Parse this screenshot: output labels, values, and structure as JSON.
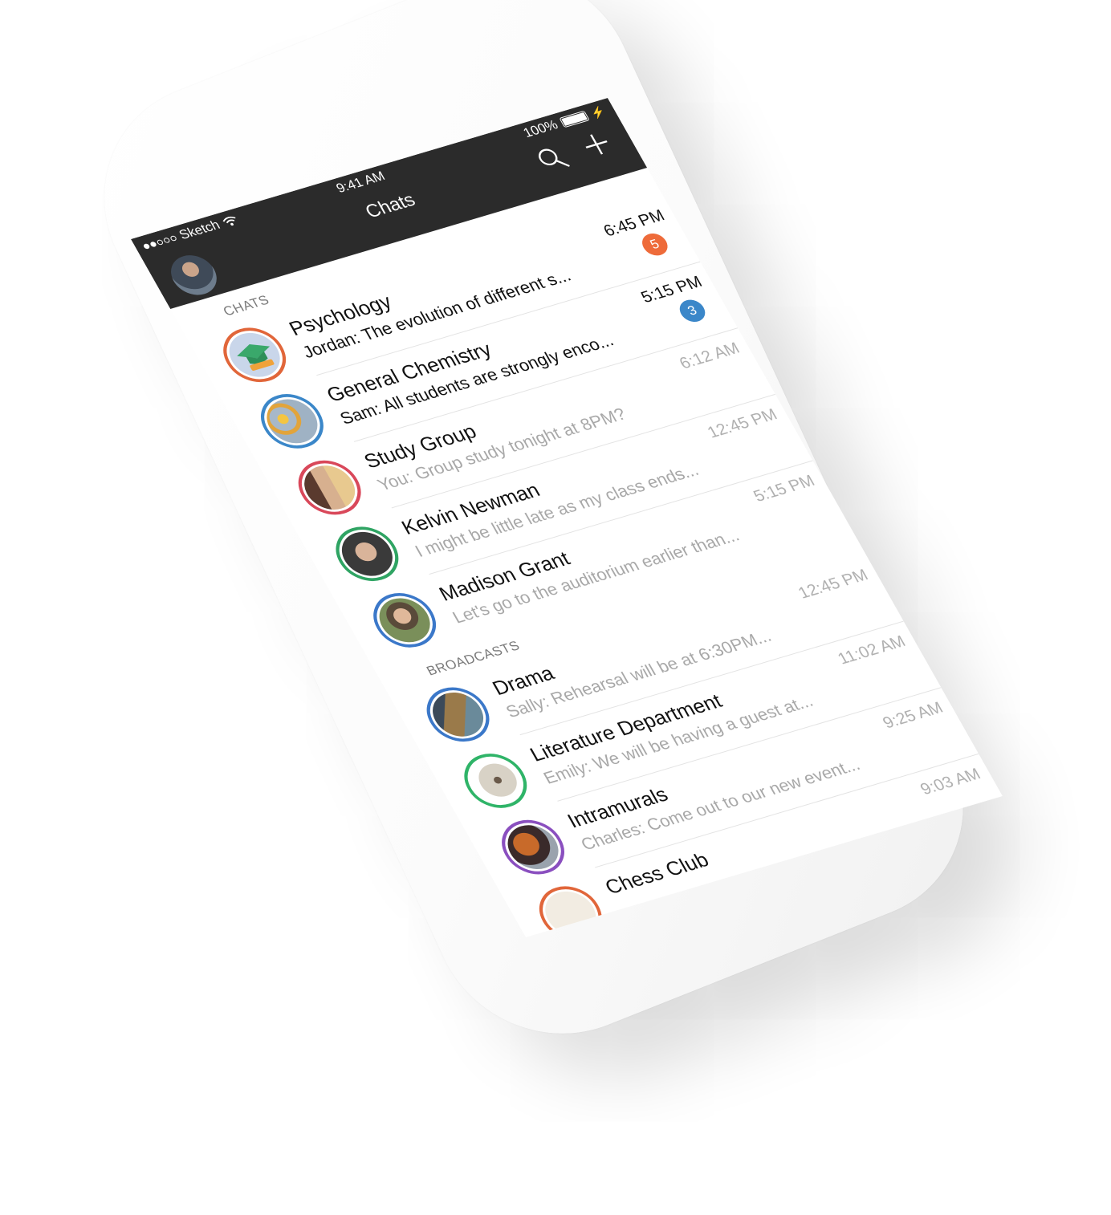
{
  "status_bar": {
    "carrier": "Sketch",
    "time": "9:41 AM",
    "battery": "100%"
  },
  "nav": {
    "title": "Chats"
  },
  "sections": {
    "chats_title": "CHATS",
    "broadcasts_title": "BROADCASTS"
  },
  "chats": [
    {
      "name": "Psychology",
      "preview": "Jordan: The evolution of different s...",
      "time": "6:45 PM",
      "badge": "5",
      "badge_color": "#ee6b3a",
      "ring": "#e1663a",
      "unread": true
    },
    {
      "name": "General Chemistry",
      "preview": "Sam: All students are strongly enco...",
      "time": "5:15 PM",
      "badge": "3",
      "badge_color": "#3b87c9",
      "ring": "#3b87c9",
      "unread": true
    },
    {
      "name": "Study Group",
      "preview": "You: Group study tonight at 8PM?",
      "time": "6:12 AM",
      "ring": "#d9485a",
      "unread": false
    },
    {
      "name": "Kelvin Newman",
      "preview": "I might be little late as my class ends...",
      "time": "12:45 PM",
      "ring": "#2fa463",
      "unread": false
    },
    {
      "name": "Madison Grant",
      "preview": "Let's go to the auditorium earlier than...",
      "time": "5:15 PM",
      "ring": "#3b78c9",
      "unread": false
    }
  ],
  "broadcasts": [
    {
      "name": "Drama",
      "preview": "Sally: Rehearsal will be at 6:30PM...",
      "time": "12:45 PM",
      "ring": "#3b78c9"
    },
    {
      "name": "Literature Department",
      "preview": "Emily: We will be having a guest at...",
      "time": "11:02 AM",
      "ring": "#2fb468"
    },
    {
      "name": "Intramurals",
      "preview": "Charles: Come out to our new event...",
      "time": "9:25 AM",
      "ring": "#8a4fbf"
    },
    {
      "name": "Chess Club",
      "preview": "",
      "time": "9:03 AM",
      "ring": "#e1663a"
    }
  ],
  "icons": {
    "search": "search-icon",
    "add": "plus-icon",
    "wifi": "wifi-icon",
    "battery": "battery-icon"
  }
}
